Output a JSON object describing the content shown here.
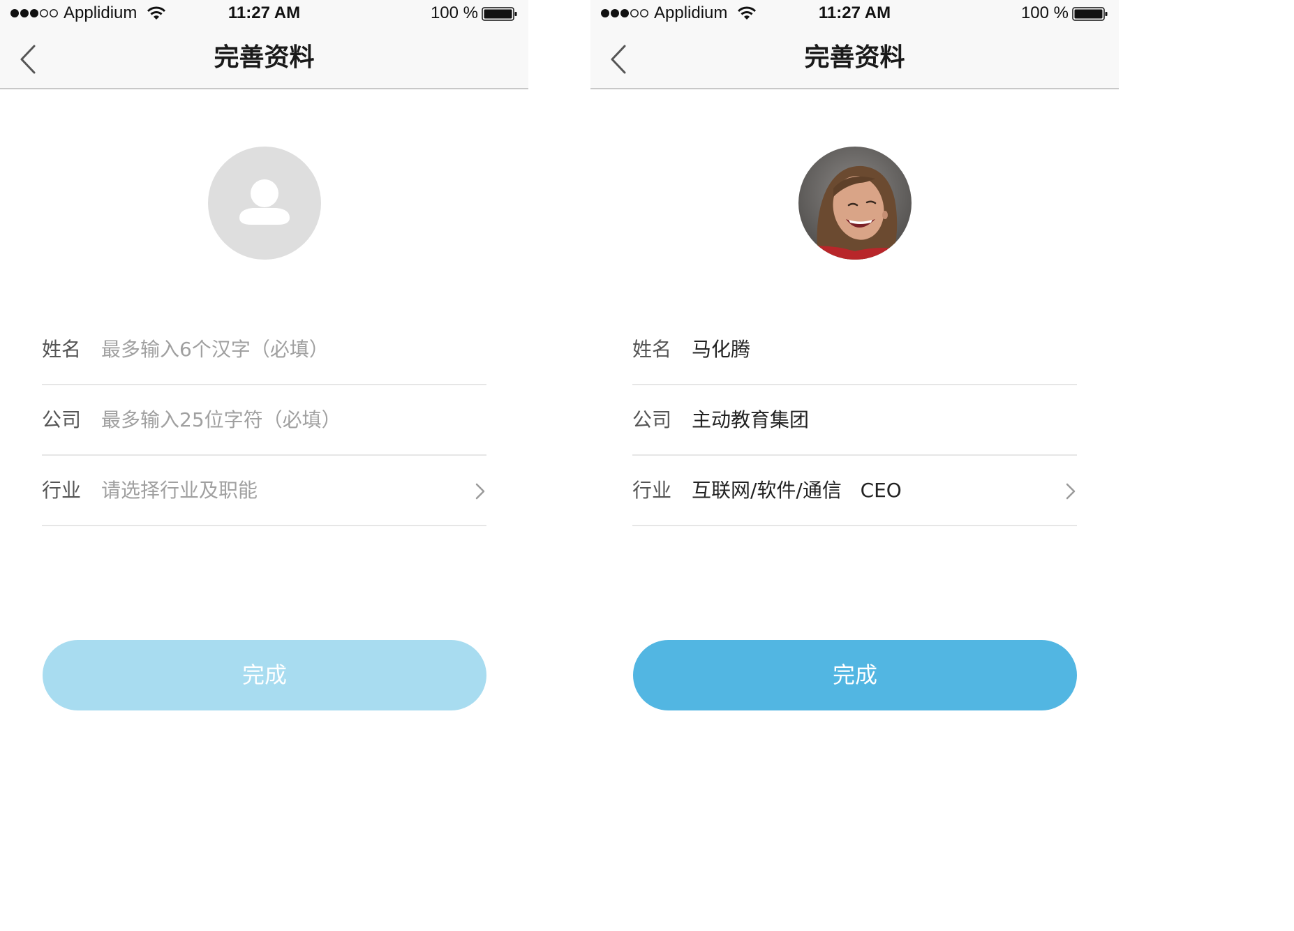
{
  "status_bar": {
    "carrier": "Applidium",
    "time": "11:27 AM",
    "battery_percent": "100 %"
  },
  "screens": [
    {
      "state": "empty",
      "nav_title": "完善资料",
      "fields": {
        "name": {
          "label": "姓名",
          "placeholder": "最多输入6个汉字（必填）",
          "value": ""
        },
        "company": {
          "label": "公司",
          "placeholder": "最多输入25位字符（必填）",
          "value": ""
        },
        "industry": {
          "label": "行业",
          "placeholder": "请选择行业及职能",
          "value": ""
        }
      },
      "done_button": {
        "label": "完成",
        "enabled": false,
        "color": "#a8dcf0"
      }
    },
    {
      "state": "filled",
      "nav_title": "完善资料",
      "fields": {
        "name": {
          "label": "姓名",
          "value": "马化腾"
        },
        "company": {
          "label": "公司",
          "value": "主动教育集团"
        },
        "industry": {
          "label": "行业",
          "value": "互联网/软件/通信   CEO"
        }
      },
      "done_button": {
        "label": "完成",
        "enabled": true,
        "color": "#52b6e2"
      }
    }
  ],
  "icons": [
    "signal-dots-icon",
    "wifi-icon",
    "battery-icon",
    "back-chevron-icon",
    "user-placeholder-icon",
    "chevron-right-icon"
  ]
}
